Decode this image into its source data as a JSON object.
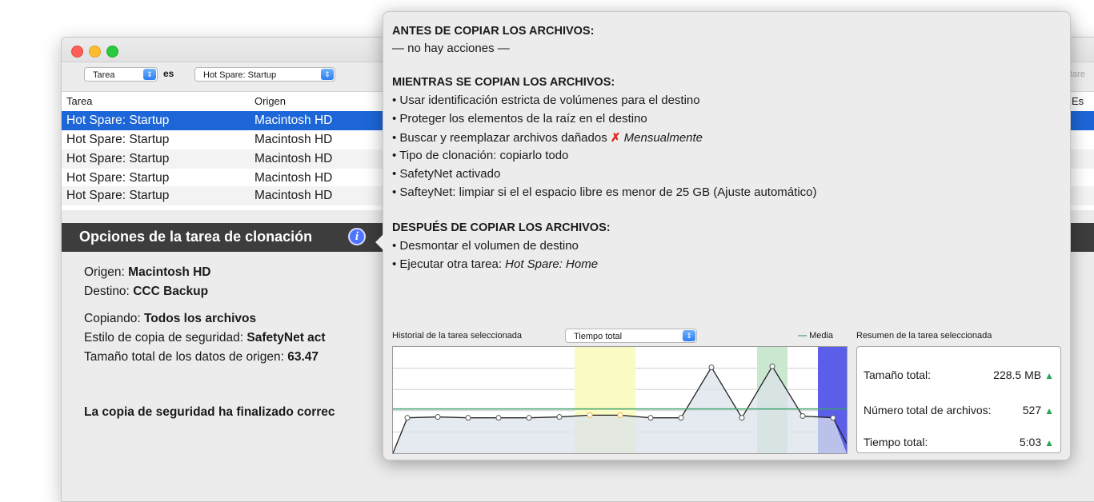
{
  "filter": {
    "field": "Tarea",
    "operator": "es",
    "value": "Hot Spare: Startup",
    "right_fragment": "tare"
  },
  "table": {
    "headers": {
      "task": "Tarea",
      "source": "Origen",
      "right_fragment": "Es"
    },
    "rows": [
      {
        "task": "Hot Spare: Startup",
        "source": "Macintosh HD",
        "selected": true
      },
      {
        "task": "Hot Spare: Startup",
        "source": "Macintosh HD"
      },
      {
        "task": "Hot Spare: Startup",
        "source": "Macintosh HD"
      },
      {
        "task": "Hot Spare: Startup",
        "source": "Macintosh HD"
      },
      {
        "task": "Hot Spare: Startup",
        "source": "Macintosh HD"
      }
    ]
  },
  "options_panel": {
    "title": "Opciones de la tarea de clonación",
    "source_label": "Origen:",
    "source_value": "Macintosh HD",
    "dest_label": "Destino:",
    "dest_value": "CCC Backup",
    "copying_label": "Copiando:",
    "copying_value": "Todos los archivos",
    "style_label": "Estilo de copia de seguridad:",
    "style_value": "SafetyNet act",
    "size_label": "Tamaño total de los datos de origen:",
    "size_value": "63.47",
    "status": "La copia de seguridad ha finalizado correc"
  },
  "popover": {
    "before_heading": "ANTES DE COPIAR LOS ARCHIVOS:",
    "before_none": "— no hay acciones —",
    "during_heading": "MIENTRAS SE COPIAN LOS ARCHIVOS:",
    "during_items": [
      "• Usar identificación estricta de volúmenes para el destino",
      "• Proteger los elementos de la raíz en el destino",
      "• Buscar y reemplazar archivos dañados",
      "• Tipo de clonación: copiarlo todo",
      "• SafetyNet activado",
      "• SafteyNet: limpiar si el el espacio libre es menor de 25 GB (Ajuste automático)"
    ],
    "during_repair_mark": "✗",
    "during_repair_freq": "Mensualmente",
    "after_heading": "DESPUÉS DE COPIAR LOS ARCHIVOS:",
    "after_items": [
      "• Desmontar el volumen de destino",
      "• Ejecutar otra tarea: "
    ],
    "after_task_name": "Hot Spare: Home",
    "history_label": "Historial de la tarea seleccionada",
    "history_select": "Tiempo total",
    "average_label": "Media",
    "summary_label": "Resumen de la tarea seleccionada",
    "summary": [
      {
        "label": "Tamaño total:",
        "value": "228.5 MB"
      },
      {
        "label": "Número total de archivos:",
        "value": "527"
      },
      {
        "label": "Tiempo total:",
        "value": "5:03"
      }
    ]
  },
  "chart_data": {
    "type": "line",
    "title": "",
    "xlabel": "",
    "ylabel": "",
    "x": [
      1,
      2,
      3,
      4,
      5,
      6,
      7,
      8,
      9,
      10,
      11,
      12,
      13,
      14,
      15
    ],
    "values": [
      0.4,
      0.41,
      0.4,
      0.4,
      0.4,
      0.41,
      0.43,
      0.43,
      0.4,
      0.4,
      0.97,
      0.4,
      0.98,
      0.42,
      0.4
    ],
    "average": 0.5,
    "ylim": [
      0,
      1.2
    ],
    "highlights": [
      {
        "color": "#fafbc4",
        "from": 7,
        "to": 8
      },
      {
        "color": "#c9e8cf",
        "from": 13,
        "to": 13
      },
      {
        "color": "#5a5ee9",
        "from": 15,
        "to": 15
      }
    ],
    "highlight_points": [
      7,
      8
    ],
    "colors": {
      "line": "#222222",
      "fill": "#dbe3ea",
      "average": "#3aa06a",
      "point_highlight": "#f0b040"
    }
  }
}
